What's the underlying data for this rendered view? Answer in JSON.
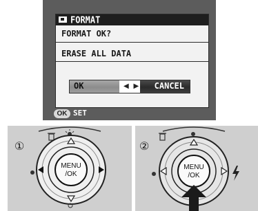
{
  "dialog": {
    "title": "FORMAT",
    "question": "FORMAT OK?",
    "warning": "ERASE ALL DATA",
    "ok_label": "OK",
    "arrows": "◀ ▶",
    "cancel_label": "CANCEL"
  },
  "footer": {
    "badge": "OK",
    "action": "SET"
  },
  "steps": {
    "step1_number": "①",
    "step2_number": "②",
    "menu_label_line1": "MENU",
    "menu_label_line2": "/OK"
  },
  "icons": {
    "title_icon": "format-card-icon",
    "press_arrow": "arrow-up-icon",
    "flash": "flash-icon",
    "macro": "macro-icon",
    "trash": "trash-icon",
    "brightness": "brightness-icon"
  },
  "colors": {
    "lcd_background": "#5c5c5c",
    "dialog_background": "#f2f2f2",
    "title_bar": "#1e1e1e",
    "selected_button": "#2a2a2a",
    "unselected_button": "#9a9a9a",
    "panel_background": "#cfcfcf"
  }
}
